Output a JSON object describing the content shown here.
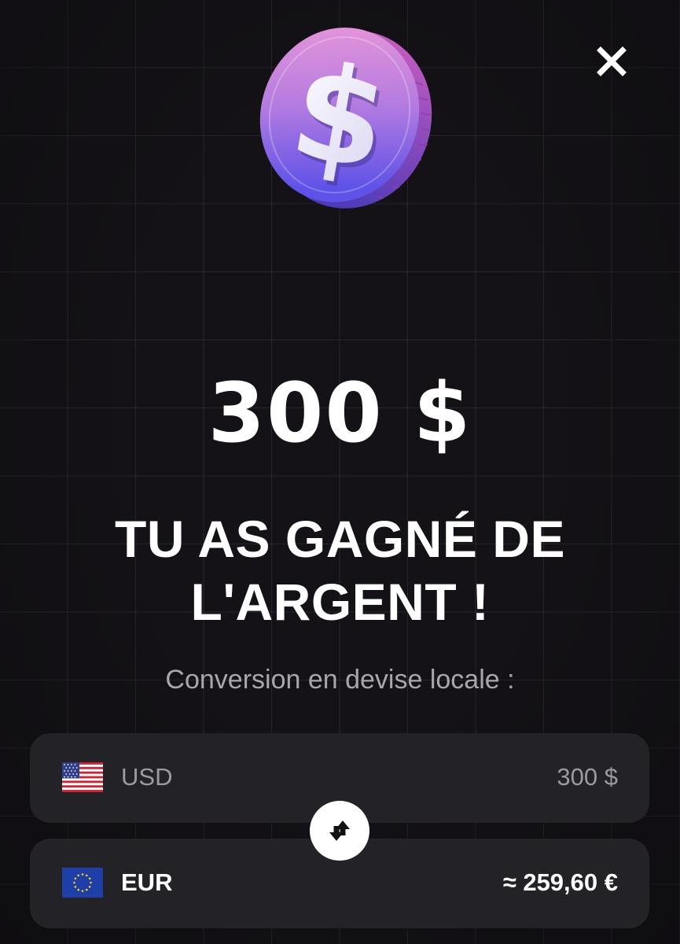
{
  "dialog": {
    "close_icon": "close-icon",
    "coin_icon": "dollar-coin-icon",
    "amount": "300 $",
    "headline_line1": "TU AS GAGNÉ DE",
    "headline_line2": "L'ARGENT !",
    "subtitle": "Conversion en devise locale :"
  },
  "conversion": {
    "swap_icon": "swap-arrows-icon",
    "from": {
      "flag_icon": "us-flag-icon",
      "code": "USD",
      "value": "300 $"
    },
    "to": {
      "flag_icon": "eu-flag-icon",
      "code": "EUR",
      "value": "≈ 259,60 €"
    }
  },
  "colors": {
    "background": "#141216",
    "row_background": "#232226",
    "coin_pink": "#e68bd6",
    "coin_purple": "#7a63e6",
    "muted_text": "#a9a6ad"
  }
}
